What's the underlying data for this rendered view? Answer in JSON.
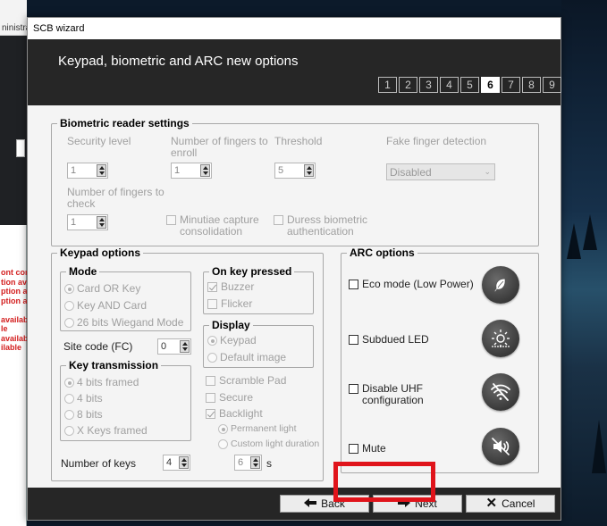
{
  "background": {
    "app_title_fragment": "ninistrat",
    "red_text_lines": [
      "ont confi",
      "tion av",
      "ption ava",
      "ption av",
      "",
      "availab",
      "le",
      "availabl",
      "ilable"
    ]
  },
  "window": {
    "title": "SCB wizard",
    "header_title": "Keypad, biometric and ARC new options",
    "steps": [
      "1",
      "2",
      "3",
      "4",
      "5",
      "6",
      "7",
      "8",
      "9"
    ],
    "active_step": "6"
  },
  "biometric": {
    "legend": "Biometric reader settings",
    "security_level_label": "Security level",
    "security_level_value": "1",
    "fingers_enroll_label": "Number of fingers to enroll",
    "fingers_enroll_value": "1",
    "threshold_label": "Threshold",
    "threshold_value": "5",
    "fake_finger_label": "Fake finger detection",
    "fake_finger_value": "Disabled",
    "fingers_check_label": "Number of fingers to check",
    "fingers_check_value": "1",
    "minutiae_label": "Minutiae capture consolidation",
    "duress_label": "Duress biometric authentication"
  },
  "keypad": {
    "legend": "Keypad options",
    "mode": {
      "legend": "Mode",
      "options": [
        "Card OR Key",
        "Key AND Card",
        "26 bits Wiegand Mode"
      ],
      "selected": "Card OR Key"
    },
    "site_code_label": "Site code (FC)",
    "site_code_value": "0",
    "key_transmission": {
      "legend": "Key transmission",
      "options": [
        "4 bits framed",
        "4 bits",
        "8 bits",
        "X Keys framed"
      ],
      "selected": "4 bits framed"
    },
    "number_of_keys_label": "Number of keys",
    "number_of_keys_value": "4",
    "on_key_pressed": {
      "legend": "On key pressed",
      "buzzer_label": "Buzzer",
      "buzzer_checked": true,
      "flicker_label": "Flicker"
    },
    "display": {
      "legend": "Display",
      "options": [
        "Keypad",
        "Default image"
      ],
      "selected": "Keypad"
    },
    "scramble_label": "Scramble Pad",
    "secure_label": "Secure",
    "backlight_label": "Backlight",
    "backlight_checked": true,
    "permanent_light_label": "Permanent light",
    "custom_light_label": "Custom light duration",
    "custom_light_value": "6",
    "custom_light_unit": "s"
  },
  "arc": {
    "legend": "ARC options",
    "eco_label": "Eco mode (Low Power)",
    "eco_icon": "leaf-icon",
    "subdued_label": "Subdued LED",
    "subdued_icon": "brightness-icon",
    "uhf_label": "Disable UHF configuration",
    "uhf_icon": "wifi-off-icon",
    "mute_label": "Mute",
    "mute_icon": "speaker-mute-icon"
  },
  "footer": {
    "back_label": "Back",
    "next_label": "Next",
    "cancel_label": "Cancel"
  },
  "colors": {
    "header_bg": "#262626",
    "highlight": "#e0141b",
    "disabled_text": "#a0a0a0"
  }
}
